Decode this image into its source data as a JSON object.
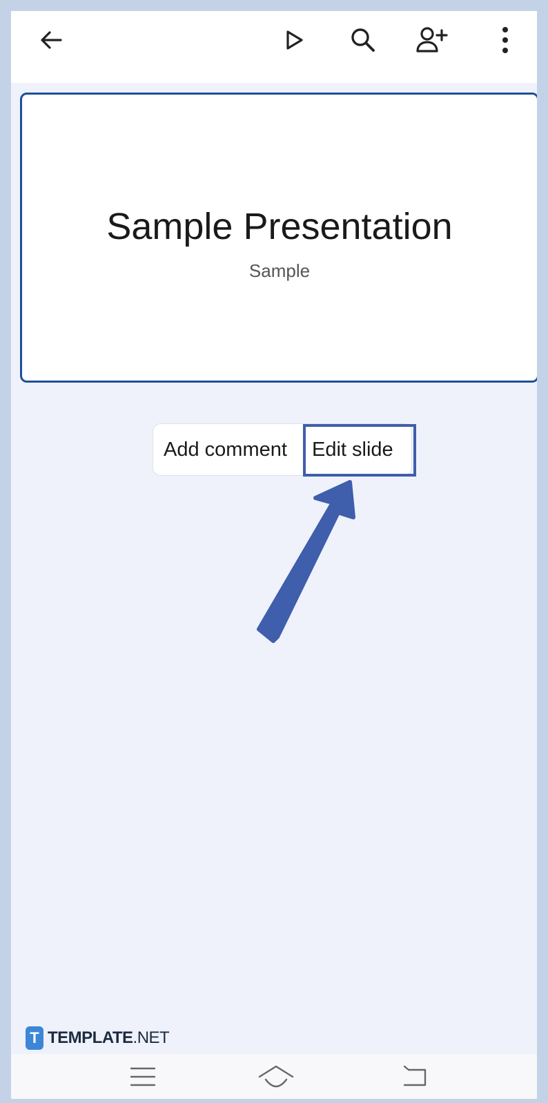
{
  "toolbar": {
    "back_icon": "arrow-left-icon",
    "present_icon": "play-icon",
    "search_icon": "search-icon",
    "share_icon": "add-person-icon",
    "more_icon": "more-vertical-icon"
  },
  "slide": {
    "title": "Sample Presentation",
    "subtitle": "Sample"
  },
  "popup": {
    "add_comment_label": "Add comment",
    "edit_slide_label": "Edit slide"
  },
  "watermark": {
    "brand_bold": "TEMPLATE",
    "brand_suffix": ".NET",
    "logo_letter": "T"
  },
  "navbar": {
    "menu_icon": "menu-icon",
    "home_icon": "home-icon",
    "back_icon": "back-icon"
  },
  "colors": {
    "accent": "#3f5eab",
    "slide_border": "#1e4f9a",
    "background": "#eff2fb"
  }
}
